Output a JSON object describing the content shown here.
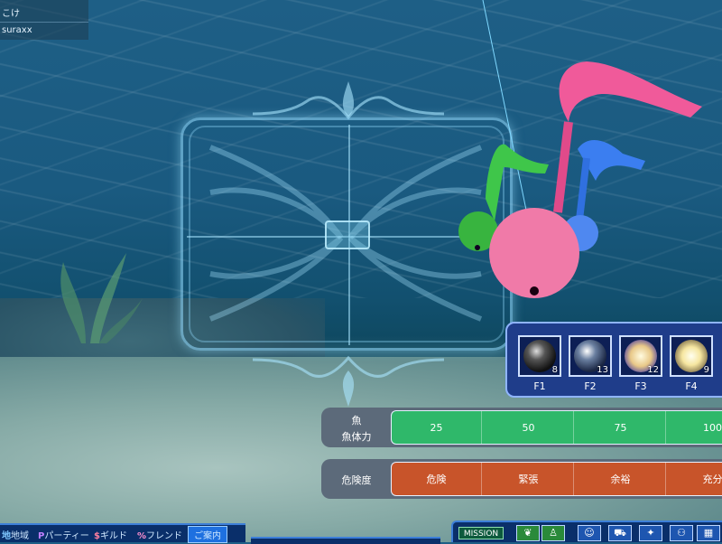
{
  "chat": {
    "lines": [
      "こけ",
      "suraxx"
    ]
  },
  "skills": [
    {
      "key": "F1",
      "count": "8",
      "orb_color": "#1a1a1a"
    },
    {
      "key": "F2",
      "count": "13",
      "orb_color": "#2a3550"
    },
    {
      "key": "F3",
      "count": "12",
      "orb_color": "#d8b070"
    },
    {
      "key": "F4",
      "count": "9",
      "orb_color": "#f0e090"
    }
  ],
  "fish_gauge": {
    "label_line1": "魚",
    "label_line2": "魚体力",
    "ticks": [
      "25",
      "50",
      "75",
      "100"
    ],
    "color": "#2fb86a"
  },
  "danger_gauge": {
    "label": "危険度",
    "ticks": [
      "危険",
      "緊張",
      "余裕",
      "充分"
    ],
    "color": "#c8542a"
  },
  "bottom_left": {
    "items": [
      {
        "icon": "地",
        "label": "地域"
      },
      {
        "icon": "P",
        "label": "パーティー"
      },
      {
        "icon": "$",
        "label": "ギルド"
      },
      {
        "icon": "%",
        "label": "フレンド"
      },
      {
        "icon": "",
        "label": "ご案内"
      }
    ]
  },
  "bottom_right": {
    "mission_label": "MISSION",
    "icons": [
      "leaf-icon",
      "person-icon",
      "character-icon",
      "car-icon",
      "sparkle-icon",
      "party-add-icon",
      "grid-icon"
    ]
  }
}
